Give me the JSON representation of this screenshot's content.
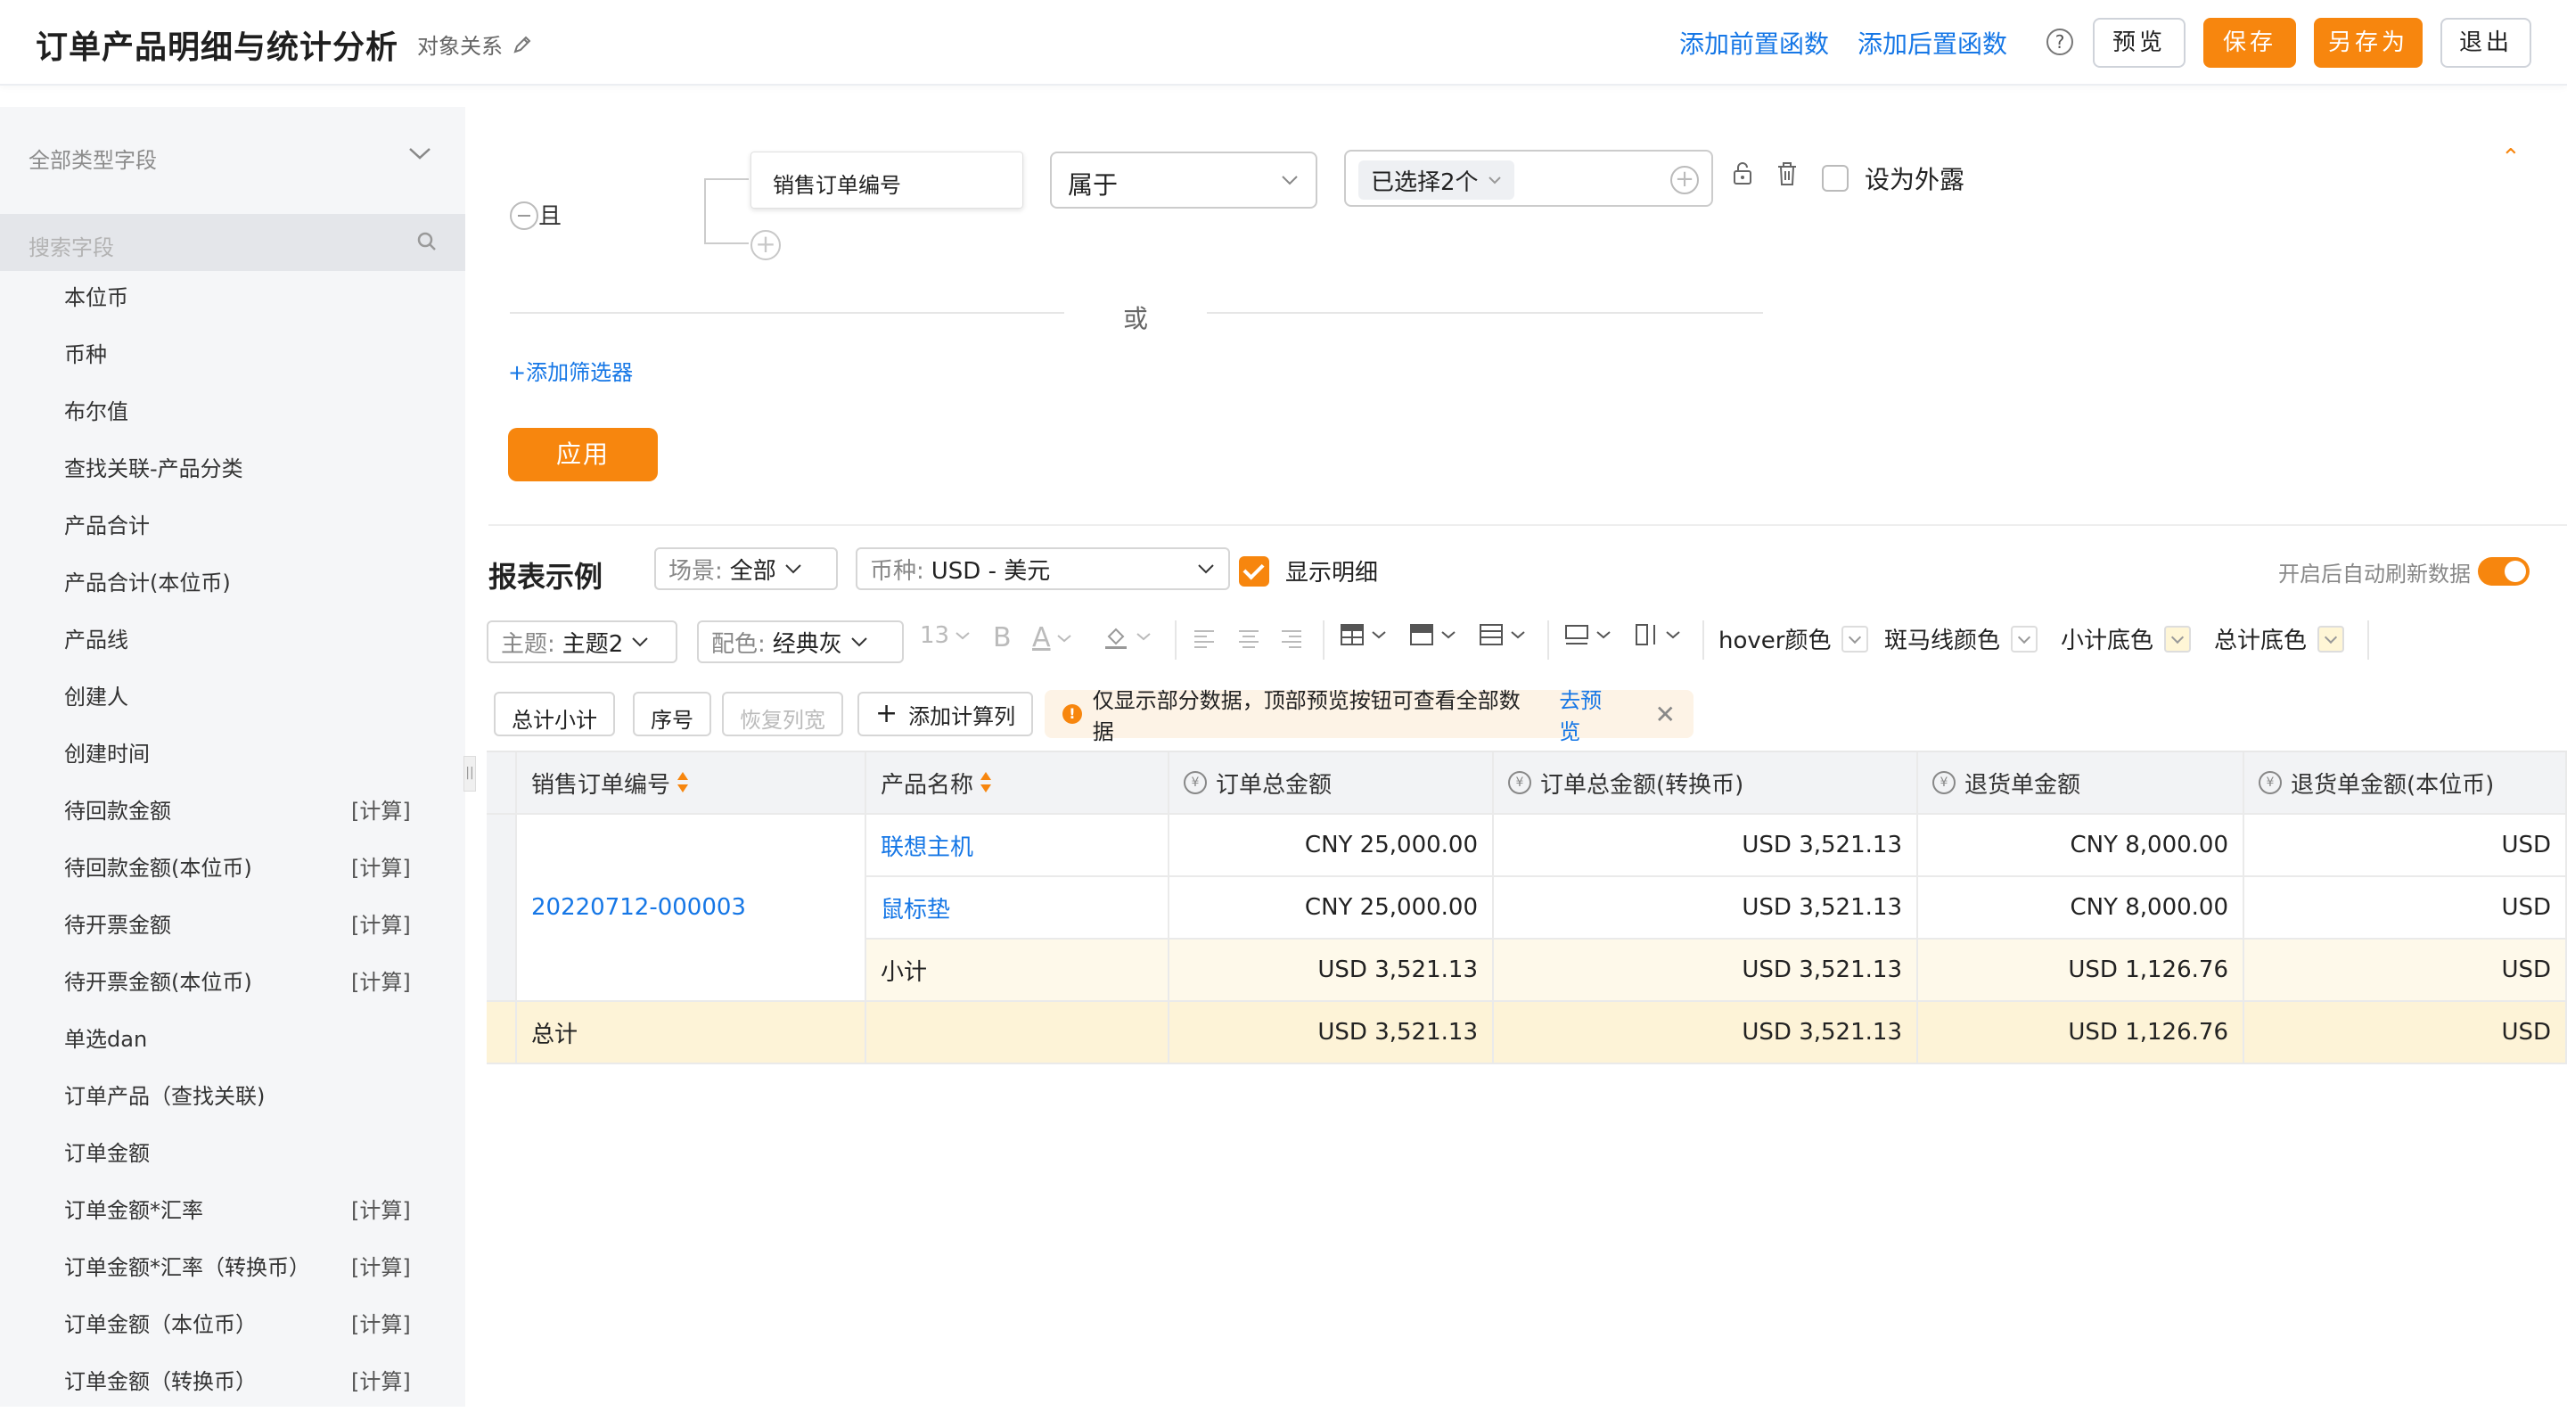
{
  "header": {
    "title": "订单产品明细与统计分析",
    "object_relation": "对象关系",
    "add_pre_func": "添加前置函数",
    "add_post_func": "添加后置函数",
    "help": "?",
    "preview": "预览",
    "save": "保存",
    "save_as": "另存为",
    "exit": "退出"
  },
  "sidebar": {
    "type_filter": "全部类型字段",
    "search_placeholder": "搜索字段",
    "items": [
      {
        "label": "本位币",
        "tag": ""
      },
      {
        "label": "币种",
        "tag": ""
      },
      {
        "label": "布尔值",
        "tag": ""
      },
      {
        "label": "查找关联-产品分类",
        "tag": ""
      },
      {
        "label": "产品合计",
        "tag": ""
      },
      {
        "label": "产品合计(本位币)",
        "tag": ""
      },
      {
        "label": "产品线",
        "tag": ""
      },
      {
        "label": "创建人",
        "tag": ""
      },
      {
        "label": "创建时间",
        "tag": ""
      },
      {
        "label": "待回款金额",
        "tag": "[计算]"
      },
      {
        "label": "待回款金额(本位币)",
        "tag": "[计算]"
      },
      {
        "label": "待开票金额",
        "tag": "[计算]"
      },
      {
        "label": "待开票金额(本位币)",
        "tag": "[计算]"
      },
      {
        "label": "单选dan",
        "tag": ""
      },
      {
        "label": "订单产品（查找关联)",
        "tag": ""
      },
      {
        "label": "订单金额",
        "tag": ""
      },
      {
        "label": "订单金额*汇率",
        "tag": "[计算]"
      },
      {
        "label": "订单金额*汇率（转换币）",
        "tag": "[计算]"
      },
      {
        "label": "订单金额（本位币）",
        "tag": "[计算]"
      },
      {
        "label": "订单金额（转换币）",
        "tag": "[计算]"
      }
    ]
  },
  "filter": {
    "logic": "且",
    "field": "销售订单编号",
    "operator": "属于",
    "value_chip": "已选择2个",
    "expose_label": "设为外露",
    "or_label": "或",
    "add_filter": "+添加筛选器",
    "apply": "应用"
  },
  "report": {
    "title": "报表示例",
    "scene_prefix": "场景:",
    "scene_value": "全部",
    "currency_prefix": "币种:",
    "currency_value": "USD - 美元",
    "show_detail": "显示明细",
    "auto_refresh": "开启后自动刷新数据",
    "theme_prefix": "主题:",
    "theme_value": "主题2",
    "color_prefix": "配色:",
    "color_value": "经典灰",
    "font_size": "13",
    "bold": "B",
    "font_color": "A",
    "hover_color": "hover颜色",
    "zebra_color": "斑马线颜色",
    "subtotal_bg": "小计底色",
    "total_bg": "总计底色",
    "btn_total_subtotal": "总计小计",
    "btn_index": "序号",
    "btn_restore_width": "恢复列宽",
    "btn_add_calc": "添加计算列",
    "notice": "仅显示部分数据，顶部预览按钮可查看全部数据",
    "notice_link": "去预览"
  },
  "table": {
    "columns": [
      "销售订单编号",
      "产品名称",
      "订单总金额",
      "订单总金额(转换币)",
      "退货单金额",
      "退货单金额(本位币)"
    ],
    "order_no": "20220712-000003",
    "rows": [
      {
        "product": "联想主机",
        "total": "CNY 25,000.00",
        "total_conv": "USD 3,521.13",
        "return": "CNY 8,000.00",
        "return_base": "USD"
      },
      {
        "product": "鼠标垫",
        "total": "CNY 25,000.00",
        "total_conv": "USD 3,521.13",
        "return": "CNY 8,000.00",
        "return_base": "USD"
      }
    ],
    "subtotal": {
      "label": "小计",
      "total": "USD 3,521.13",
      "total_conv": "USD 3,521.13",
      "return": "USD 1,126.76",
      "return_base": "USD"
    },
    "grand_total": {
      "label": "总计",
      "total": "USD 3,521.13",
      "total_conv": "USD 3,521.13",
      "return": "USD 1,126.76",
      "return_base": "USD"
    }
  }
}
